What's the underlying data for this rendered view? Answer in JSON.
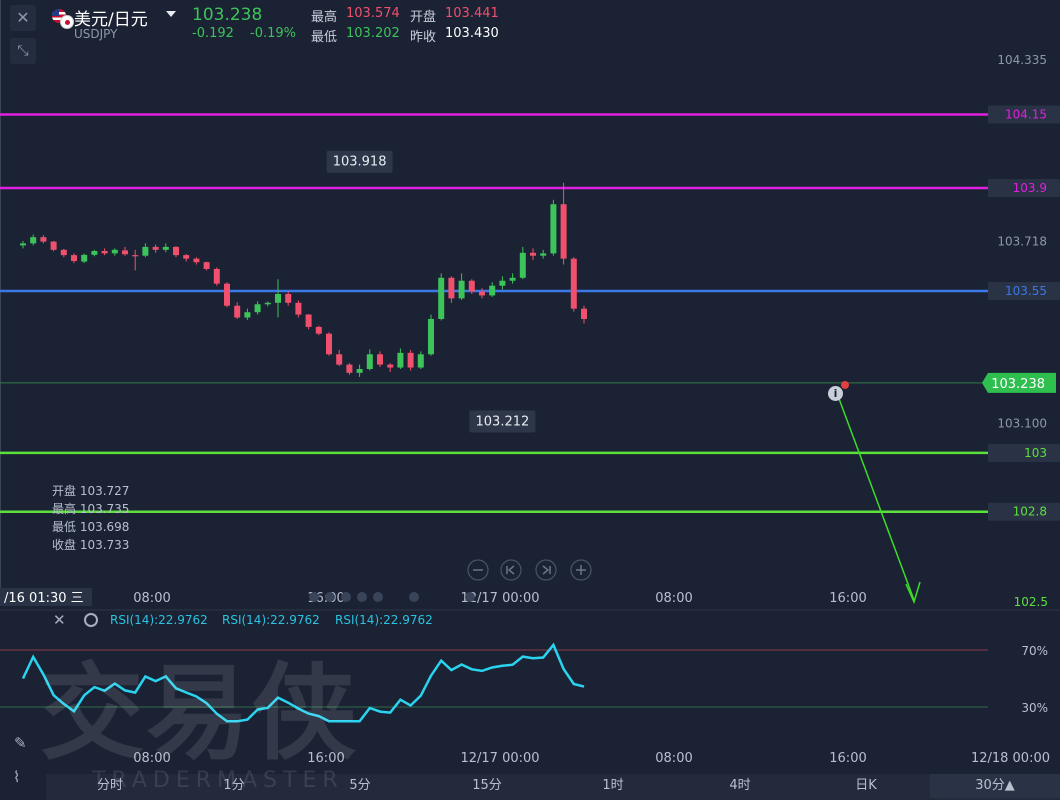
{
  "header": {
    "pair_name": "美元/日元",
    "symbol": "USDJPY",
    "price": "103.238",
    "change": "-0.192",
    "change_pct": "-0.19%",
    "high_label": "最高",
    "high_value": "103.574",
    "low_label": "最低",
    "low_value": "103.202",
    "open_label": "开盘",
    "open_value": "103.441",
    "prev_label": "昨收",
    "prev_value": "103.430"
  },
  "ohlc_panel": {
    "open": "开盘 103.727",
    "high": "最高 103.735",
    "low": "最低 103.698",
    "close": "收盘 103.733"
  },
  "rsi_labels": [
    "RSI(14):22.9762",
    "RSI(14):22.9762",
    "RSI(14):22.9762"
  ],
  "timeframes": [
    {
      "label": "分时",
      "active": false
    },
    {
      "label": "1分",
      "active": false
    },
    {
      "label": "5分",
      "active": false
    },
    {
      "label": "15分",
      "active": false
    },
    {
      "label": "1时",
      "active": false
    },
    {
      "label": "4时",
      "active": false
    },
    {
      "label": "日K",
      "active": false
    },
    {
      "label": "30分▲",
      "active": true
    }
  ],
  "watermark": {
    "cn": "交易侠",
    "en": "TRADERMASTER"
  },
  "colors": {
    "background": "#1b2233",
    "up": "#3cc35a",
    "down": "#f0506e",
    "magenta_line": "#e020e0",
    "blue_line": "#3c78e6",
    "green_line": "#5ce03c",
    "rsi_line": "#2ad4f0",
    "price_tag": "#2fbf4f"
  },
  "chart_data": {
    "type": "candlestick",
    "y_axis": {
      "range": [
        102.5,
        104.539
      ],
      "tick_labels": [
        {
          "value": 104.335,
          "label": "104.335"
        },
        {
          "value": 103.718,
          "label": "103.718"
        },
        {
          "value": 103.1,
          "label": "103.100"
        }
      ]
    },
    "x_axis": {
      "tick_labels": [
        "08:00",
        "16:00",
        "12/17 00:00",
        "08:00",
        "16:00"
      ],
      "tick_slots": [
        9,
        19,
        29,
        39,
        49
      ],
      "crosshair_label": "/16 01:30 三"
    },
    "horizontal_lines": [
      {
        "value": 104.15,
        "label": "104.15",
        "color": "#e020e0"
      },
      {
        "value": 103.9,
        "label": "103.9",
        "color": "#e020e0"
      },
      {
        "value": 103.55,
        "label": "103.55",
        "color": "#3c78e6"
      },
      {
        "value": 103.0,
        "label": "103",
        "color": "#5ce03c"
      },
      {
        "value": 102.8,
        "label": "102.8",
        "color": "#5ce03c"
      }
    ],
    "current_price": {
      "value": 103.238,
      "label": "103.238"
    },
    "axis_bottom_label": "102.5",
    "annotations": [
      {
        "label": "103.918",
        "value": 103.918,
        "slot": 33
      },
      {
        "label": "103.212",
        "value": 103.212,
        "slot": 47
      }
    ],
    "candles": [
      {
        "o": 103.705,
        "h": 103.72,
        "l": 103.695,
        "c": 103.712
      },
      {
        "o": 103.712,
        "h": 103.742,
        "l": 103.705,
        "c": 103.733
      },
      {
        "o": 103.733,
        "h": 103.74,
        "l": 103.712,
        "c": 103.718
      },
      {
        "o": 103.718,
        "h": 103.72,
        "l": 103.685,
        "c": 103.69
      },
      {
        "o": 103.69,
        "h": 103.693,
        "l": 103.665,
        "c": 103.672
      },
      {
        "o": 103.672,
        "h": 103.678,
        "l": 103.645,
        "c": 103.652
      },
      {
        "o": 103.65,
        "h": 103.677,
        "l": 103.645,
        "c": 103.673
      },
      {
        "o": 103.673,
        "h": 103.69,
        "l": 103.668,
        "c": 103.686
      },
      {
        "o": 103.686,
        "h": 103.695,
        "l": 103.672,
        "c": 103.678
      },
      {
        "o": 103.678,
        "h": 103.695,
        "l": 103.67,
        "c": 103.69
      },
      {
        "o": 103.688,
        "h": 103.7,
        "l": 103.67,
        "c": 103.675
      },
      {
        "o": 103.672,
        "h": 103.69,
        "l": 103.62,
        "c": 103.67
      },
      {
        "o": 103.67,
        "h": 103.712,
        "l": 103.665,
        "c": 103.7
      },
      {
        "o": 103.7,
        "h": 103.708,
        "l": 103.68,
        "c": 103.69
      },
      {
        "o": 103.69,
        "h": 103.712,
        "l": 103.682,
        "c": 103.7
      },
      {
        "o": 103.7,
        "h": 103.702,
        "l": 103.665,
        "c": 103.672
      },
      {
        "o": 103.672,
        "h": 103.676,
        "l": 103.65,
        "c": 103.66
      },
      {
        "o": 103.66,
        "h": 103.665,
        "l": 103.64,
        "c": 103.648
      },
      {
        "o": 103.648,
        "h": 103.65,
        "l": 103.62,
        "c": 103.625
      },
      {
        "o": 103.625,
        "h": 103.63,
        "l": 103.568,
        "c": 103.575
      },
      {
        "o": 103.575,
        "h": 103.58,
        "l": 103.495,
        "c": 103.5
      },
      {
        "o": 103.5,
        "h": 103.512,
        "l": 103.455,
        "c": 103.46
      },
      {
        "o": 103.46,
        "h": 103.49,
        "l": 103.452,
        "c": 103.478
      },
      {
        "o": 103.478,
        "h": 103.515,
        "l": 103.47,
        "c": 103.505
      },
      {
        "o": 103.505,
        "h": 103.515,
        "l": 103.498,
        "c": 103.51
      },
      {
        "o": 103.51,
        "h": 103.59,
        "l": 103.46,
        "c": 103.54
      },
      {
        "o": 103.54,
        "h": 103.55,
        "l": 103.5,
        "c": 103.51
      },
      {
        "o": 103.51,
        "h": 103.518,
        "l": 103.46,
        "c": 103.47
      },
      {
        "o": 103.47,
        "h": 103.472,
        "l": 103.42,
        "c": 103.428
      },
      {
        "o": 103.428,
        "h": 103.432,
        "l": 103.4,
        "c": 103.405
      },
      {
        "o": 103.405,
        "h": 103.41,
        "l": 103.33,
        "c": 103.335
      },
      {
        "o": 103.335,
        "h": 103.35,
        "l": 103.295,
        "c": 103.3
      },
      {
        "o": 103.3,
        "h": 103.305,
        "l": 103.265,
        "c": 103.272
      },
      {
        "o": 103.272,
        "h": 103.3,
        "l": 103.258,
        "c": 103.285
      },
      {
        "o": 103.285,
        "h": 103.352,
        "l": 103.28,
        "c": 103.335
      },
      {
        "o": 103.335,
        "h": 103.345,
        "l": 103.292,
        "c": 103.3
      },
      {
        "o": 103.3,
        "h": 103.305,
        "l": 103.275,
        "c": 103.29
      },
      {
        "o": 103.29,
        "h": 103.355,
        "l": 103.285,
        "c": 103.34
      },
      {
        "o": 103.34,
        "h": 103.35,
        "l": 103.28,
        "c": 103.29
      },
      {
        "o": 103.29,
        "h": 103.345,
        "l": 103.285,
        "c": 103.335
      },
      {
        "o": 103.335,
        "h": 103.47,
        "l": 103.33,
        "c": 103.455
      },
      {
        "o": 103.455,
        "h": 103.61,
        "l": 103.45,
        "c": 103.595
      },
      {
        "o": 103.595,
        "h": 103.6,
        "l": 103.51,
        "c": 103.525
      },
      {
        "o": 103.525,
        "h": 103.61,
        "l": 103.52,
        "c": 103.585
      },
      {
        "o": 103.585,
        "h": 103.59,
        "l": 103.54,
        "c": 103.548
      },
      {
        "o": 103.548,
        "h": 103.56,
        "l": 103.525,
        "c": 103.535
      },
      {
        "o": 103.535,
        "h": 103.58,
        "l": 103.53,
        "c": 103.568
      },
      {
        "o": 103.568,
        "h": 103.6,
        "l": 103.555,
        "c": 103.585
      },
      {
        "o": 103.585,
        "h": 103.61,
        "l": 103.575,
        "c": 103.595
      },
      {
        "o": 103.595,
        "h": 103.7,
        "l": 103.59,
        "c": 103.68
      },
      {
        "o": 103.68,
        "h": 103.695,
        "l": 103.655,
        "c": 103.67
      },
      {
        "o": 103.67,
        "h": 103.69,
        "l": 103.66,
        "c": 103.678
      },
      {
        "o": 103.678,
        "h": 103.86,
        "l": 103.67,
        "c": 103.845
      },
      {
        "o": 103.845,
        "h": 103.918,
        "l": 103.64,
        "c": 103.66
      },
      {
        "o": 103.66,
        "h": 103.665,
        "l": 103.48,
        "c": 103.49
      },
      {
        "o": 103.49,
        "h": 103.5,
        "l": 103.44,
        "c": 103.455
      }
    ]
  }
}
